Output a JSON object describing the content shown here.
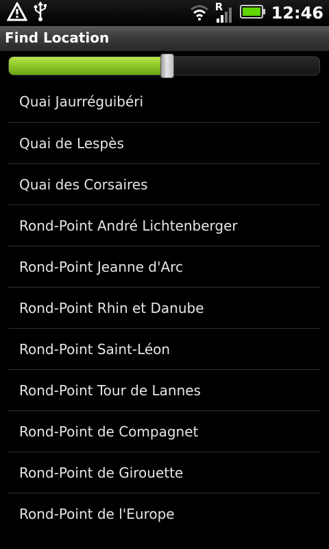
{
  "status_bar": {
    "time": "12:46",
    "icons": [
      "warning-icon",
      "usb-icon",
      "wifi-icon",
      "roaming-signal-icon",
      "battery-icon"
    ],
    "roaming_indicator": "R",
    "battery_color": "#5fd400"
  },
  "title_bar": {
    "title": "Find Location"
  },
  "slider": {
    "value_percent": 51,
    "fill_color": "#8fc92b"
  },
  "locations": [
    "Quai Jaurréguibéri",
    "Quai de Lespès",
    "Quai des Corsaires",
    "Rond-Point André Lichtenberger",
    "Rond-Point Jeanne d'Arc",
    "Rond-Point Rhin et Danube",
    "Rond-Point Saint-Léon",
    "Rond-Point Tour de Lannes",
    "Rond-Point de Compagnet",
    "Rond-Point de Girouette",
    "Rond-Point de l'Europe"
  ]
}
